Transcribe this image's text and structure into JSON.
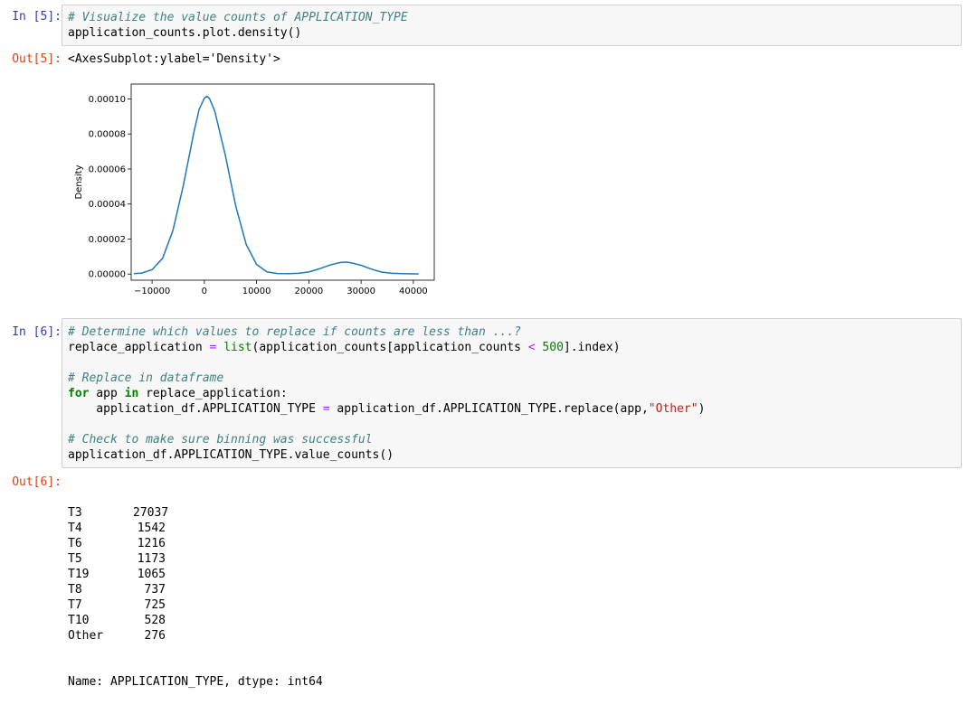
{
  "cells": [
    {
      "prompt_in": "In [5]:",
      "code": {
        "comment": "# Visualize the value counts of APPLICATION_TYPE",
        "line2": "application_counts.plot.density()"
      },
      "prompt_out": "Out[5]:",
      "output_repr": "<AxesSubplot:ylabel='Density'>"
    },
    {
      "prompt_in": "In [6]:",
      "code": {
        "comment1": "# Determine which values to replace if counts are less than ...?",
        "l2_a": "replace_application ",
        "l2_b": "=",
        "l2_c": " ",
        "l2_d": "list",
        "l2_e": "(application_counts[application_counts ",
        "l2_f": "<",
        "l2_g": " ",
        "l2_h": "500",
        "l2_i": "].index)",
        "comment2": "# Replace in dataframe",
        "l5_for": "for",
        "l5_a": " app ",
        "l5_in": "in",
        "l5_b": " replace_application:",
        "l6_a": "    application_df.APPLICATION_TYPE ",
        "l6_b": "=",
        "l6_c": " application_df.APPLICATION_TYPE.replace(app,",
        "l6_str": "\"Other\"",
        "l6_d": ")",
        "comment3": "# Check to make sure binning was successful",
        "l9": "application_df.APPLICATION_TYPE.value_counts()"
      },
      "prompt_out": "Out[6]:",
      "value_counts": [
        {
          "label": "T3",
          "value": "27037"
        },
        {
          "label": "T4",
          "value": "1542"
        },
        {
          "label": "T6",
          "value": "1216"
        },
        {
          "label": "T5",
          "value": "1173"
        },
        {
          "label": "T19",
          "value": "1065"
        },
        {
          "label": "T8",
          "value": "737"
        },
        {
          "label": "T7",
          "value": "725"
        },
        {
          "label": "T10",
          "value": "528"
        },
        {
          "label": "Other",
          "value": "276"
        }
      ],
      "footer": "Name: APPLICATION_TYPE, dtype: int64"
    }
  ],
  "chart_data": {
    "type": "line",
    "title": "",
    "xlabel": "",
    "ylabel": "Density",
    "xlim": [
      -14000,
      44000
    ],
    "ylim": [
      -3.5e-06,
      0.0001085
    ],
    "x_ticks": [
      -10000,
      0,
      10000,
      20000,
      30000,
      40000
    ],
    "x_tick_labels": [
      "−10000",
      "0",
      "10000",
      "20000",
      "30000",
      "40000"
    ],
    "y_ticks": [
      0,
      2e-05,
      4e-05,
      6e-05,
      8e-05,
      0.0001
    ],
    "y_tick_labels": [
      "0.00000",
      "0.00002",
      "0.00004",
      "0.00006",
      "0.00008",
      "0.00010"
    ],
    "grid": false,
    "series_color": "#1f77b4",
    "x": [
      -13500,
      -12000,
      -10000,
      -8000,
      -6000,
      -4000,
      -2000,
      -1000,
      0,
      500,
      1000,
      2000,
      4000,
      6000,
      8000,
      10000,
      12000,
      14000,
      16000,
      18000,
      20000,
      22000,
      24000,
      26000,
      27000,
      28000,
      30000,
      32000,
      34000,
      36000,
      38000,
      40000,
      41000
    ],
    "y": [
      2e-07,
      6e-07,
      2.5e-06,
      9e-06,
      2.5e-05,
      5.1e-05,
      8.1e-05,
      9.4e-05,
      0.0001005,
      0.0001015,
      0.0001002,
      9.3e-05,
      6.8e-05,
      3.9e-05,
      1.7e-05,
      5.5e-06,
      1.2e-06,
      3e-07,
      2e-07,
      4e-07,
      1.2e-06,
      3e-06,
      5.1e-06,
      6.6e-06,
      6.8e-06,
      6.5e-06,
      5e-06,
      2.8e-06,
      1.1e-06,
      4e-07,
      2e-07,
      1e-07,
      1e-07
    ]
  }
}
